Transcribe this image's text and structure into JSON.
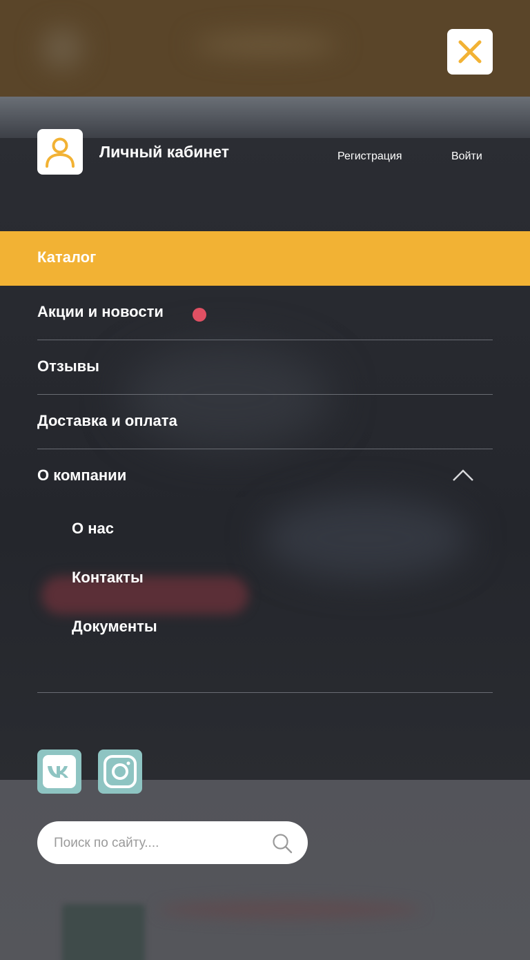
{
  "header": {
    "close_icon": "close-icon"
  },
  "account": {
    "title": "Личный кабинет",
    "register_label": "Регистрация",
    "login_label": "Войти",
    "icon": "user-icon"
  },
  "menu": {
    "items": [
      {
        "label": "Каталог",
        "active": true
      },
      {
        "label": "Акции и новости",
        "has_badge": true
      },
      {
        "label": "Отзывы"
      },
      {
        "label": "Доставка и оплата"
      }
    ],
    "company": {
      "label": "О компании",
      "expanded": true,
      "subitems": [
        {
          "label": "О нас"
        },
        {
          "label": "Контакты"
        },
        {
          "label": "Документы"
        }
      ]
    }
  },
  "social": [
    {
      "name": "vk-icon"
    },
    {
      "name": "instagram-icon"
    }
  ],
  "search": {
    "placeholder": "Поиск по сайту...."
  },
  "colors": {
    "accent": "#f2b234",
    "badge": "#e05063",
    "social_bg": "#8ec4c2",
    "overlay": "#2d2f36"
  }
}
